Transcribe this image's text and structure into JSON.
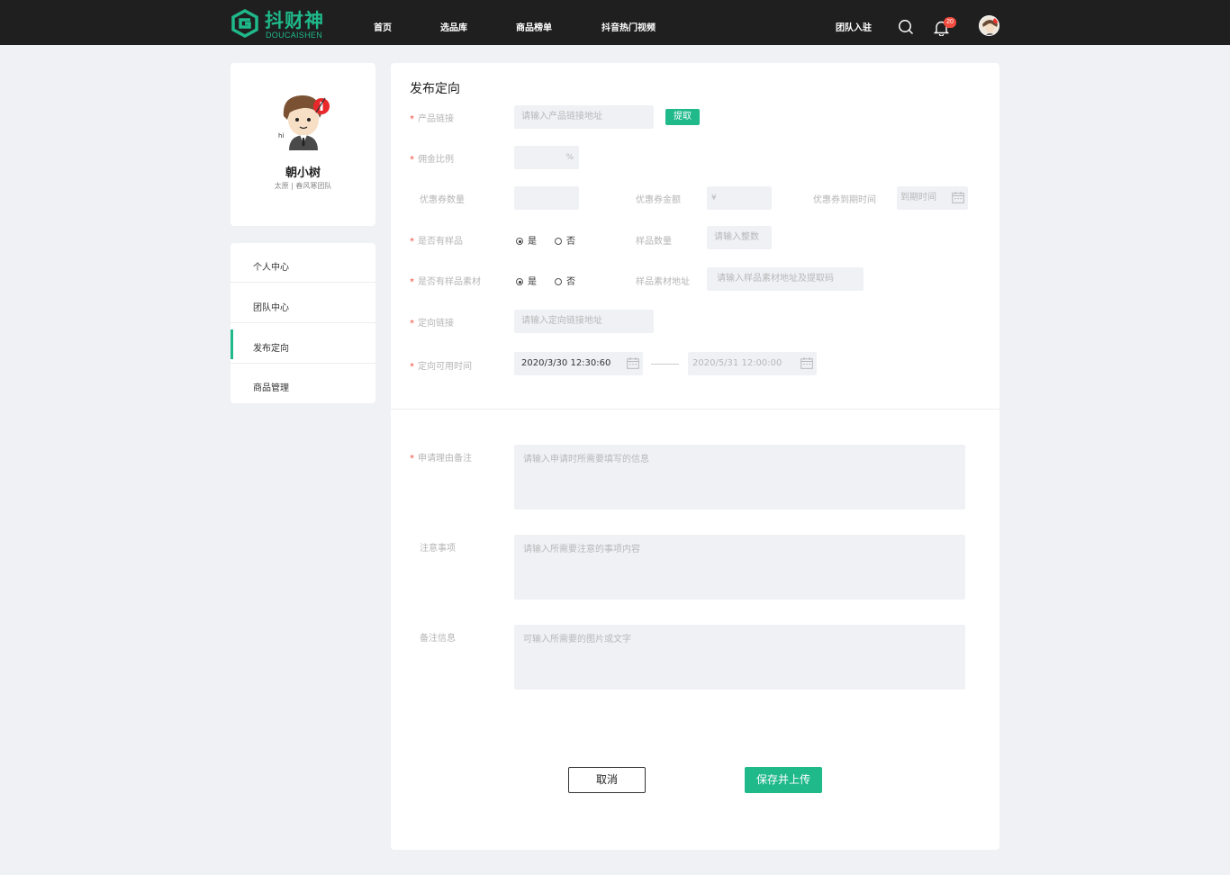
{
  "header": {
    "brand": "抖财神",
    "brand_en": "DOUCAISHEN",
    "nav": [
      "首页",
      "选品库",
      "商品榜单",
      "抖音热门视频"
    ],
    "join": "团队入驻",
    "notification_count": "20",
    "accent": "#1fb98a"
  },
  "profile": {
    "name": "朝小树",
    "org": "太原 | 春风寒团队"
  },
  "side_menu": {
    "items": [
      "个人中心",
      "团队中心",
      "发布定向",
      "商品管理"
    ],
    "active": "发布定向"
  },
  "form": {
    "title": "发布定向",
    "product_link": {
      "label": "产品链接",
      "placeholder": "请输入产品链接地址",
      "button": "提取"
    },
    "commission": {
      "label": "佣金比例",
      "unit": "%"
    },
    "coupon_qty": {
      "label": "优惠券数量"
    },
    "coupon_amount": {
      "label": "优惠券金额",
      "unit": "¥"
    },
    "coupon_expire": {
      "label": "优惠券到期时间",
      "placeholder": "到期时间"
    },
    "has_sample": {
      "label": "是否有样品",
      "yes": "是",
      "no": "否"
    },
    "sample_qty": {
      "label": "样品数量",
      "placeholder": "请输入整数"
    },
    "has_material": {
      "label": "是否有样品素材",
      "yes": "是",
      "no": "否"
    },
    "material_url": {
      "label": "样品素材地址",
      "placeholder": "请输入样品素材地址及提取码"
    },
    "target_link": {
      "label": "定向链接",
      "placeholder": "请输入定向链接地址"
    },
    "available_time": {
      "label": "定向可用时间",
      "start": "2020/3/30  12:30:60",
      "end": "2020/5/31  12:00:00"
    },
    "reason": {
      "label": "申请理由备注",
      "placeholder": "请输入申请时所需要填写的信息"
    },
    "notes": {
      "label": "注意事项",
      "placeholder": "请输入所需要注意的事项内容"
    },
    "remark": {
      "label": "备注信息",
      "placeholder": "可输入所需要的图片或文字"
    },
    "cancel": "取消",
    "save": "保存并上传"
  }
}
